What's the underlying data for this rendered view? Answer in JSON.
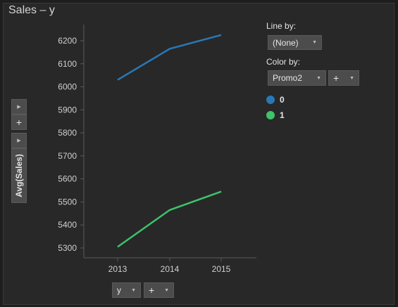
{
  "title": "Sales – y",
  "controls": {
    "line_by_label": "Line by:",
    "line_by_value": "(None)",
    "color_by_label": "Color by:",
    "color_by_value": "Promo2",
    "plus": "+",
    "y_axis_value": "Avg(Sales)",
    "x_axis_value": "y"
  },
  "legend": [
    {
      "label": "0",
      "color": "#2878b8"
    },
    {
      "label": "1",
      "color": "#3ec26a"
    }
  ],
  "chart_data": {
    "type": "line",
    "x": [
      "2013",
      "2014",
      "2015"
    ],
    "series": [
      {
        "name": "0",
        "color": "#2878b8",
        "values": [
          6030,
          6165,
          6225
        ]
      },
      {
        "name": "1",
        "color": "#3ec26a",
        "values": [
          5305,
          5465,
          5545
        ]
      }
    ],
    "ylabel": "Avg(Sales)",
    "xlabel": "y",
    "ylim": [
      5250,
      6260
    ],
    "yticks": [
      5300,
      5400,
      5500,
      5600,
      5700,
      5800,
      5900,
      6000,
      6100,
      6200
    ],
    "grid": false,
    "legend_position": "right"
  }
}
